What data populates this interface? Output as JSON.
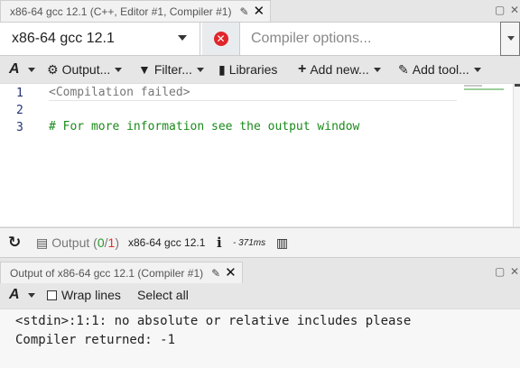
{
  "editor_tab": {
    "title": "x86-64 gcc 12.1 (C++, Editor #1, Compiler #1)"
  },
  "compiler": {
    "selected": "x86-64 gcc 12.1",
    "options_placeholder": "Compiler options..."
  },
  "toolbar": {
    "font_icon": "A",
    "output_label": "Output...",
    "filter_label": "Filter...",
    "libraries_label": "Libraries",
    "add_new_label": "Add new...",
    "add_tool_label": "Add tool..."
  },
  "editor": {
    "lines": [
      {
        "no": "1",
        "text": "<Compilation failed>",
        "kind": "fail"
      },
      {
        "no": "2",
        "text": "",
        "kind": "blank"
      },
      {
        "no": "3",
        "text": "# For more information see the output window",
        "kind": "comment"
      }
    ]
  },
  "status": {
    "output_label": "Output (",
    "success_count": "0",
    "slash": "/",
    "error_count": "1",
    "close_paren": ")",
    "compiler_name": "x86-64 gcc 12.1",
    "time": "- 371ms"
  },
  "output_tab": {
    "title": "Output of x86-64 gcc 12.1 (Compiler #1)"
  },
  "output_toolbar": {
    "font_icon": "A",
    "wrap_label": "Wrap lines",
    "select_all_label": "Select all"
  },
  "output": {
    "lines": [
      "<stdin>:1:1: no absolute or relative includes please",
      "Compiler returned: -1"
    ]
  },
  "colors": {
    "error_red": "#e0262b",
    "comment_green": "#1a8a1a",
    "success_green": "#2a9a2a"
  }
}
